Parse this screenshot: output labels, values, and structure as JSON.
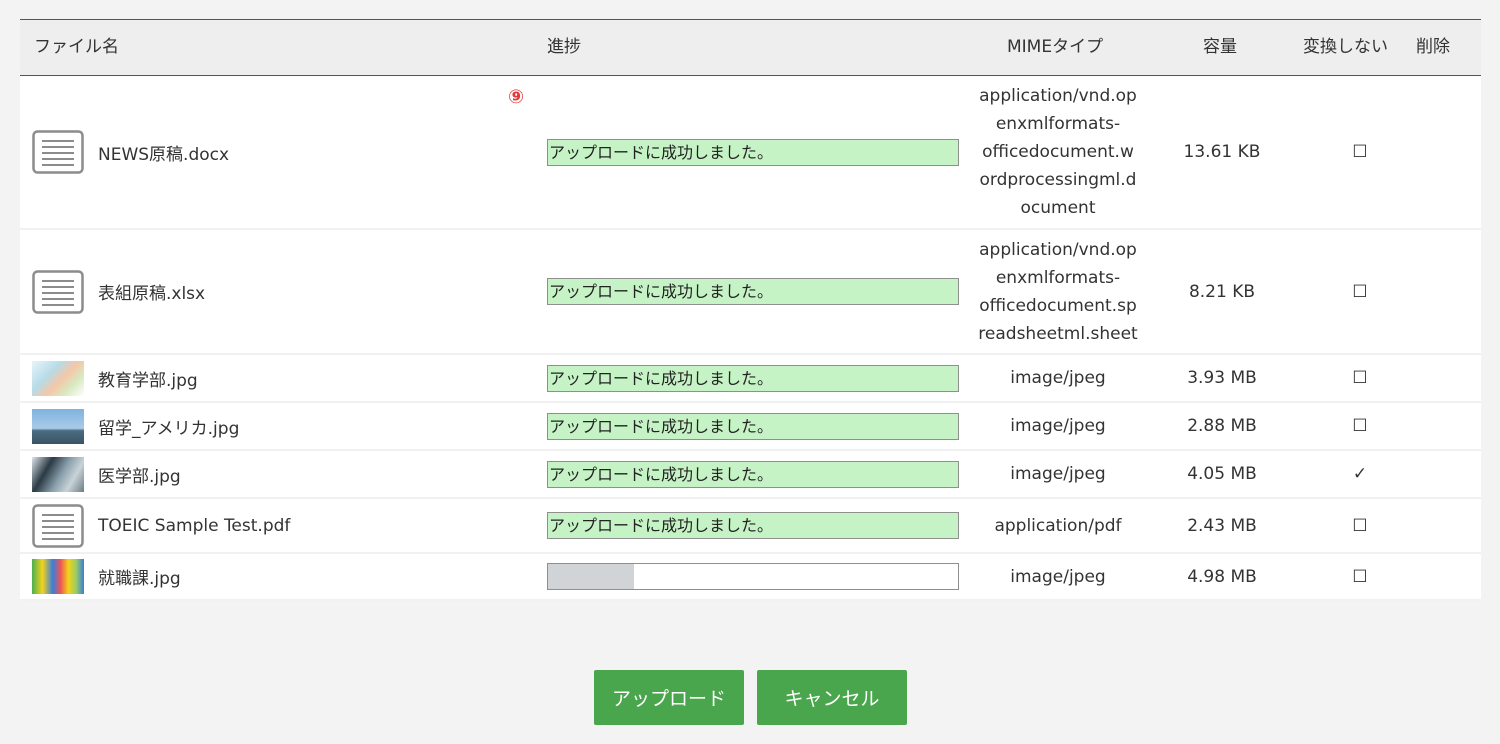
{
  "columns": {
    "file_name": "ファイル名",
    "progress": "進捗",
    "mime": "MIMEタイプ",
    "size": "容量",
    "no_convert": "変換しない",
    "delete": "削除"
  },
  "rows": [
    {
      "icon": "document-icon",
      "name": "NEWS原稿.docx",
      "status": "アップロードに成功しました。",
      "progress": 1.0,
      "mime": "application/vnd.op\nenxmlformats-\nofficedocument.w\nordprocessingml.d\nocument",
      "size": "13.61 KB",
      "no_convert": "☐"
    },
    {
      "icon": "document-icon",
      "name": "表組原稿.xlsx",
      "status": "アップロードに成功しました。",
      "progress": 1.0,
      "mime": "application/vnd.op\nenxmlformats-\nofficedocument.sp\nreadsheetml.sheet",
      "size": "8.21 KB",
      "no_convert": "☐"
    },
    {
      "icon": "image-thumbnail",
      "name": "教育学部.jpg",
      "status": "アップロードに成功しました。",
      "progress": 1.0,
      "mime": "image/jpeg",
      "size": "3.93 MB",
      "no_convert": "☐"
    },
    {
      "icon": "image-thumbnail",
      "name": "留学_アメリカ.jpg",
      "status": "アップロードに成功しました。",
      "progress": 1.0,
      "mime": "image/jpeg",
      "size": "2.88 MB",
      "no_convert": "☐"
    },
    {
      "icon": "image-thumbnail",
      "name": "医学部.jpg",
      "status": "アップロードに成功しました。",
      "progress": 1.0,
      "mime": "image/jpeg",
      "size": "4.05 MB",
      "no_convert": "✓"
    },
    {
      "icon": "document-icon",
      "name": "TOEIC Sample Test.pdf",
      "status": "アップロードに成功しました。",
      "progress": 1.0,
      "mime": "application/pdf",
      "size": "2.43 MB",
      "no_convert": "☐"
    },
    {
      "icon": "image-thumbnail",
      "name": "就職課.jpg",
      "status": "",
      "progress": 0.21,
      "mime": "image/jpeg",
      "size": "4.98 MB",
      "no_convert": "☐"
    }
  ],
  "annotation_marker": "⑨",
  "buttons": {
    "upload": "アップロード",
    "cancel": "キャンセル"
  },
  "colors": {
    "success": "#c6f3c6",
    "partial": "#d0d4d6",
    "button": "#4aa64d",
    "marker": "#e53935"
  }
}
